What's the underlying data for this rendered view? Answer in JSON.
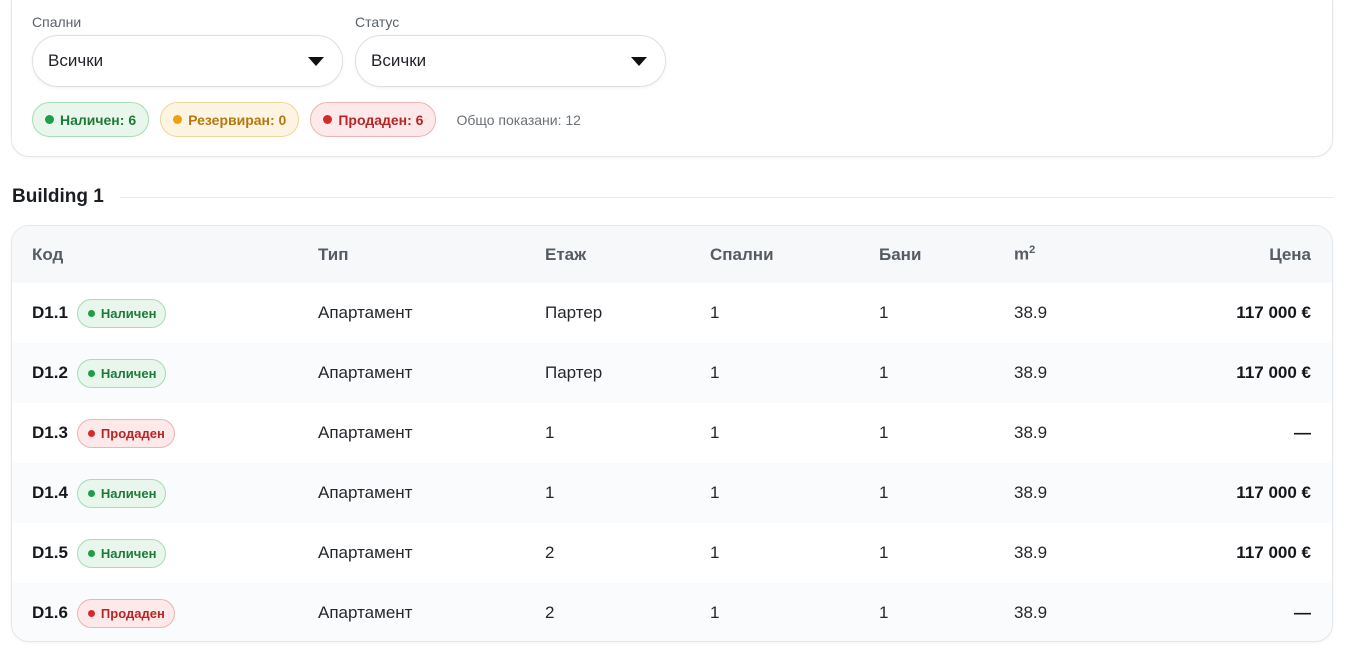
{
  "filters": {
    "bedrooms": {
      "label": "Спални",
      "value": "Всички"
    },
    "status": {
      "label": "Статус",
      "value": "Всички"
    }
  },
  "summary": {
    "available": "Наличен: 6",
    "reserved": "Резервиран: 0",
    "sold": "Продаден: 6",
    "total": "Общо показани: 12"
  },
  "colors": {
    "available": "#1e9e48",
    "reserved": "#f0a10f",
    "sold": "#d52a2a"
  },
  "building": {
    "title": "Building 1",
    "columns": {
      "code": "Код",
      "type": "Тип",
      "floor": "Етаж",
      "bedrooms": "Спални",
      "bathrooms": "Бани",
      "area": "m",
      "area_sup": "2",
      "price": "Цена"
    },
    "rows": [
      {
        "code": "D1.1",
        "status": "Наличен",
        "status_key": "green",
        "type": "Апартамент",
        "floor": "Партер",
        "bedrooms": "1",
        "bathrooms": "1",
        "area": "38.9",
        "price": "117 000 €"
      },
      {
        "code": "D1.2",
        "status": "Наличен",
        "status_key": "green",
        "type": "Апартамент",
        "floor": "Партер",
        "bedrooms": "1",
        "bathrooms": "1",
        "area": "38.9",
        "price": "117 000 €"
      },
      {
        "code": "D1.3",
        "status": "Продаден",
        "status_key": "red",
        "type": "Апартамент",
        "floor": "1",
        "bedrooms": "1",
        "bathrooms": "1",
        "area": "38.9",
        "price": "—"
      },
      {
        "code": "D1.4",
        "status": "Наличен",
        "status_key": "green",
        "type": "Апартамент",
        "floor": "1",
        "bedrooms": "1",
        "bathrooms": "1",
        "area": "38.9",
        "price": "117 000 €"
      },
      {
        "code": "D1.5",
        "status": "Наличен",
        "status_key": "green",
        "type": "Апартамент",
        "floor": "2",
        "bedrooms": "1",
        "bathrooms": "1",
        "area": "38.9",
        "price": "117 000 €"
      },
      {
        "code": "D1.6",
        "status": "Продаден",
        "status_key": "red",
        "type": "Апартамент",
        "floor": "2",
        "bedrooms": "1",
        "bathrooms": "1",
        "area": "38.9",
        "price": "—"
      }
    ]
  }
}
